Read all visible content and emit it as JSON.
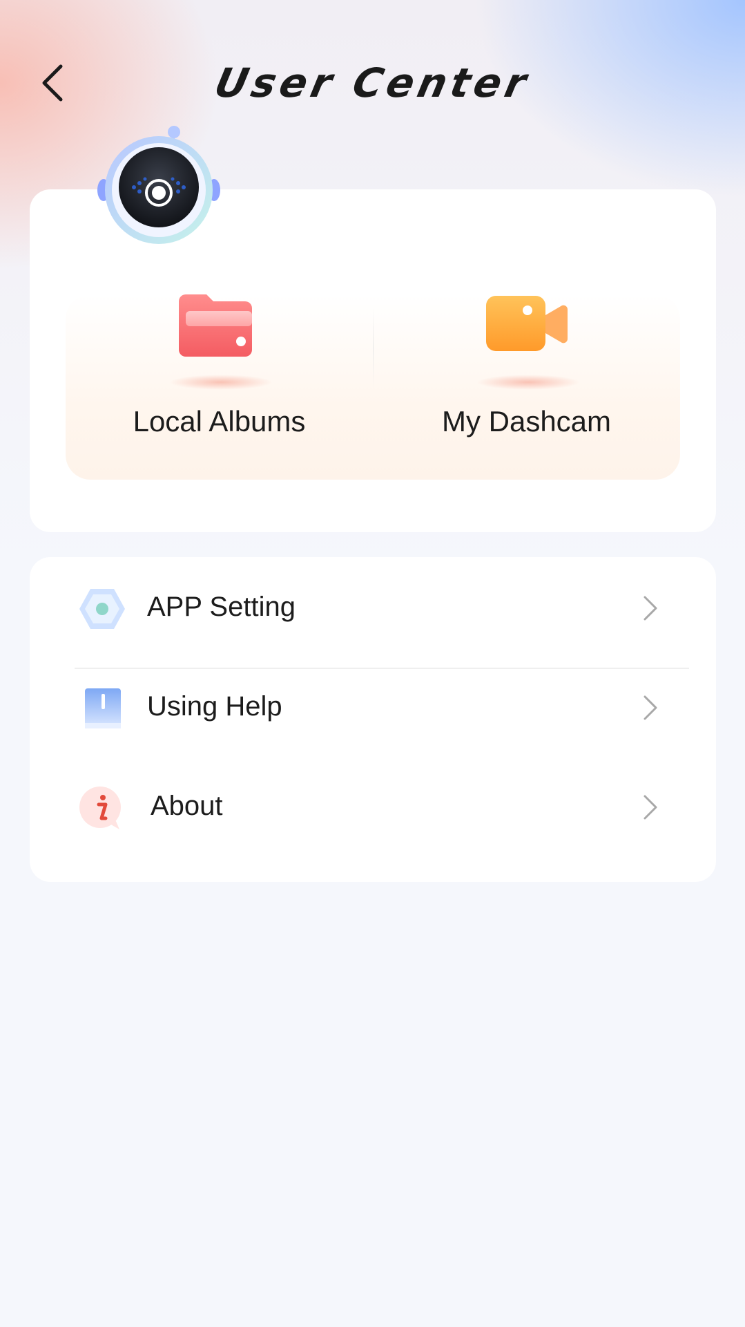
{
  "header": {
    "title": "User Center",
    "back_icon": "chevron-left-icon"
  },
  "mascot": {
    "icon": "camera-mascot-icon"
  },
  "quick_actions": [
    {
      "label": "Local Albums",
      "icon": "folder-icon",
      "color": "#f76a6a"
    },
    {
      "label": "My Dashcam",
      "icon": "video-camera-icon",
      "color": "#ffa935"
    }
  ],
  "menu": [
    {
      "label": "APP Setting",
      "icon": "settings-hexagon-icon"
    },
    {
      "label": "Using Help",
      "icon": "help-book-icon"
    },
    {
      "label": "About",
      "icon": "info-icon"
    }
  ],
  "colors": {
    "background": "#f5f7fc",
    "card": "#ffffff",
    "text": "#1c1c1c",
    "chevron": "#a8a8a8"
  }
}
